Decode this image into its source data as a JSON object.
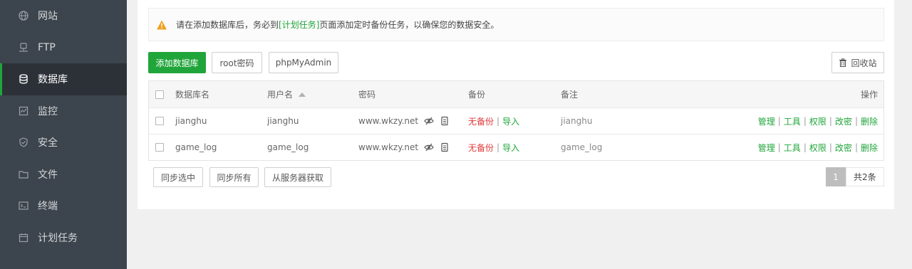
{
  "sidebar": {
    "items": [
      {
        "label": "网站",
        "icon": "globe-icon",
        "active": false
      },
      {
        "label": "FTP",
        "icon": "ftp-icon",
        "active": false
      },
      {
        "label": "数据库",
        "icon": "database-icon",
        "active": true
      },
      {
        "label": "监控",
        "icon": "monitor-icon",
        "active": false
      },
      {
        "label": "安全",
        "icon": "shield-icon",
        "active": false
      },
      {
        "label": "文件",
        "icon": "folder-icon",
        "active": false
      },
      {
        "label": "终端",
        "icon": "terminal-icon",
        "active": false
      },
      {
        "label": "计划任务",
        "icon": "calendar-icon",
        "active": false
      }
    ]
  },
  "alert": {
    "before": "请在添加数据库后，务必到",
    "link": "[计划任务]",
    "after": "页面添加定时备份任务，以确保您的数据安全。"
  },
  "toolbar": {
    "add_db": "添加数据库",
    "root_pwd": "root密码",
    "phpmyadmin": "phpMyAdmin",
    "recycle": "回收站"
  },
  "table": {
    "headers": {
      "name": "数据库名",
      "user": "用户名",
      "password": "密码",
      "backup": "备份",
      "note": "备注",
      "ops": "操作"
    },
    "rows": [
      {
        "name": "jianghu",
        "user": "jianghu",
        "password": "www.wkzy.net",
        "backup_status": "无备份",
        "backup_sep": "|",
        "import": "导入",
        "note": "jianghu",
        "ops": [
          "管理",
          "工具",
          "权限",
          "改密",
          "删除"
        ]
      },
      {
        "name": "game_log",
        "user": "game_log",
        "password": "www.wkzy.net",
        "backup_status": "无备份",
        "backup_sep": "|",
        "import": "导入",
        "note": "game_log",
        "ops": [
          "管理",
          "工具",
          "权限",
          "改密",
          "删除"
        ]
      }
    ]
  },
  "footer": {
    "sync_selected": "同步选中",
    "sync_all": "同步所有",
    "from_server": "从服务器获取",
    "page": "1",
    "total": "共2条"
  },
  "colors": {
    "accent": "#20a53a",
    "sidebar_bg": "#3c444d",
    "sidebar_active": "#2c3138",
    "danger": "#e03a3a"
  }
}
